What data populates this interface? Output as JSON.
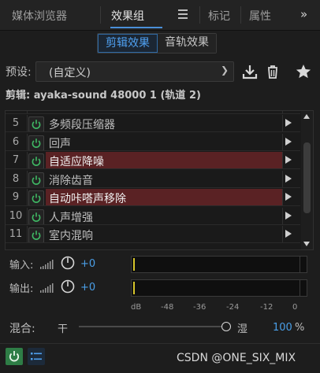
{
  "tabs": {
    "media_browser": "媒体浏览器",
    "effects_group": "效果组",
    "markers": "标记",
    "properties": "属性"
  },
  "mode": {
    "clip_effects": "剪辑效果",
    "track_effects": "音轨效果"
  },
  "preset": {
    "label": "预设:",
    "value": "(自定义)"
  },
  "clip": {
    "line": "剪辑: ayaka-sound 48000 1 (轨道 2)"
  },
  "effects": [
    {
      "num": "5",
      "name": "多频段压缩器",
      "highlight": false
    },
    {
      "num": "6",
      "name": "回声",
      "highlight": false
    },
    {
      "num": "7",
      "name": "自适应降噪",
      "highlight": true
    },
    {
      "num": "8",
      "name": "消除齿音",
      "highlight": false
    },
    {
      "num": "9",
      "name": "自动咔嗒声移除",
      "highlight": true
    },
    {
      "num": "10",
      "name": "人声增强",
      "highlight": false
    },
    {
      "num": "11",
      "name": "室内混响",
      "highlight": false
    }
  ],
  "input": {
    "label": "输入:",
    "gain": "+0"
  },
  "output": {
    "label": "输出:",
    "gain": "+0"
  },
  "meter_scale": [
    "dB",
    "-48",
    "-36",
    "-24",
    "-12",
    "0"
  ],
  "mix": {
    "label": "混合:",
    "dry": "干",
    "wet": "湿",
    "value": "100",
    "unit": "%"
  },
  "footer": {
    "watermark": "CSDN @ONE_SIX_MIX"
  },
  "colors": {
    "accent": "#4a9fe8",
    "power": "#3fb964",
    "highlight": "#5a2224"
  }
}
